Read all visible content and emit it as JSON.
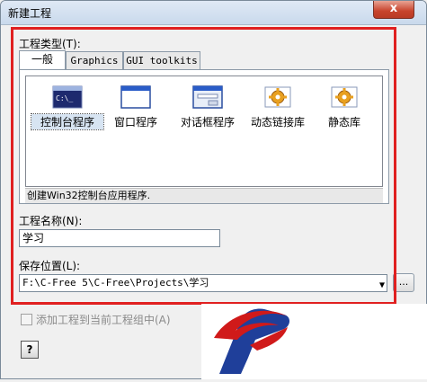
{
  "window": {
    "title": "新建工程",
    "close_label": "x"
  },
  "project_type": {
    "label": "工程类型(T):",
    "tabs": [
      {
        "label": "一般"
      },
      {
        "label": "Graphics"
      },
      {
        "label": "GUI toolkits"
      }
    ],
    "items": [
      {
        "label": "控制台程序",
        "icon": "console-icon",
        "selected": true
      },
      {
        "label": "窗口程序",
        "icon": "window-icon",
        "selected": false
      },
      {
        "label": "对话框程序",
        "icon": "dialog-icon",
        "selected": false
      },
      {
        "label": "动态链接库",
        "icon": "dll-gear-icon",
        "selected": false
      },
      {
        "label": "静态库",
        "icon": "lib-gear-icon",
        "selected": false
      }
    ],
    "description": "创建Win32控制台应用程序."
  },
  "project_name": {
    "label": "工程名称(N):",
    "value": "学习"
  },
  "save_location": {
    "label": "保存位置(L):",
    "value": "F:\\C-Free 5\\C-Free\\Projects\\学习",
    "browse_label": "..."
  },
  "add_to_group": {
    "label": "添加工程到当前工程组中(A)"
  },
  "help": {
    "label": "?"
  },
  "colors": {
    "highlight_border": "#e02020",
    "logo_red": "#d01a1a",
    "logo_blue": "#1f3f9a"
  }
}
